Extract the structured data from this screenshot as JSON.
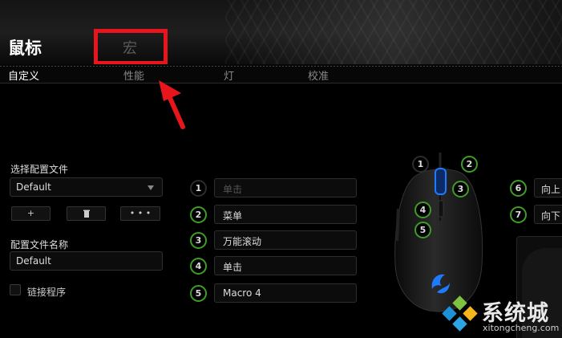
{
  "header": {
    "title": "鼠标",
    "macro_tab": "宏"
  },
  "tabs": [
    {
      "label": "自定义",
      "active": true
    },
    {
      "label": "性能",
      "active": false
    },
    {
      "label": "灯",
      "active": false
    },
    {
      "label": "校准",
      "active": false
    }
  ],
  "profile": {
    "select_label": "选择配置文件",
    "selected_profile": "Default",
    "buttons": {
      "add": "+",
      "delete_icon": "trash-icon",
      "more": "• • •"
    },
    "name_label": "配置文件名称",
    "name_value": "Default",
    "link_program_label": "链接程序",
    "link_program_checked": false
  },
  "bindings": [
    {
      "num": "1",
      "value": "单击",
      "dim": true
    },
    {
      "num": "2",
      "value": "菜单",
      "dim": false
    },
    {
      "num": "3",
      "value": "万能滚动",
      "dim": false
    },
    {
      "num": "4",
      "value": "单击",
      "dim": false
    },
    {
      "num": "5",
      "value": "Macro 4",
      "dim": false
    }
  ],
  "mouse_diagram": {
    "callouts": [
      "1",
      "2",
      "3",
      "4",
      "5"
    ]
  },
  "right_bindings": [
    {
      "num": "6",
      "value": "向上"
    },
    {
      "num": "7",
      "value": "向下"
    }
  ],
  "watermark": {
    "text": "系统城",
    "url": "xitongcheng.com"
  },
  "colors": {
    "highlight_red": "#e8161c",
    "razer_green": "#3f9d26",
    "scroll_blue": "#1e7bff"
  }
}
